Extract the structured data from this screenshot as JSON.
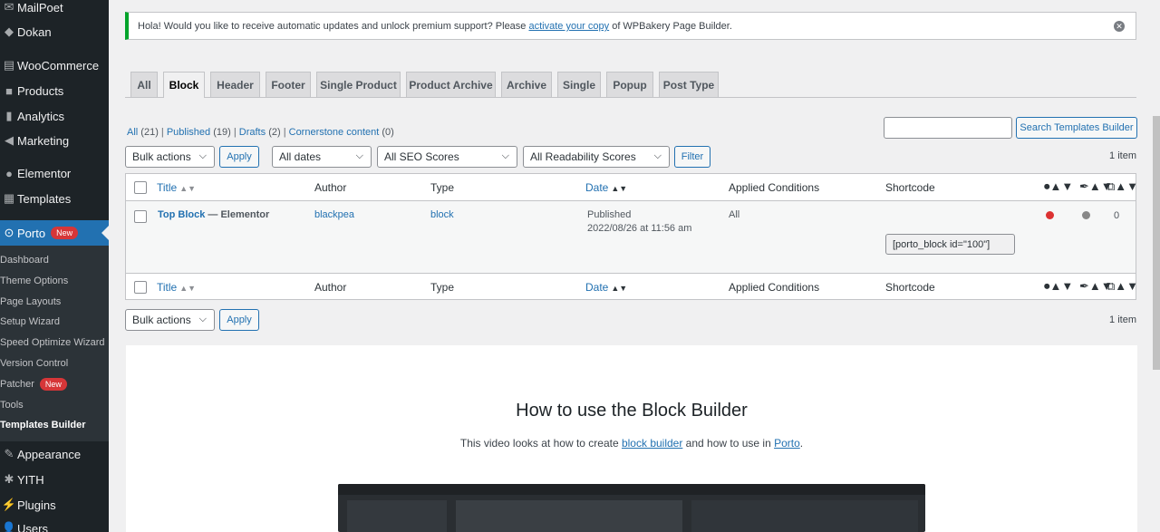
{
  "sidebar": {
    "items": [
      {
        "label": "MailPoet",
        "icon": "mailpoet-icon"
      },
      {
        "label": "Dokan",
        "icon": "dokan-icon"
      },
      {
        "label": "WooCommerce",
        "icon": "woocommerce-icon"
      },
      {
        "label": "Products",
        "icon": "products-icon"
      },
      {
        "label": "Analytics",
        "icon": "analytics-icon"
      },
      {
        "label": "Marketing",
        "icon": "marketing-icon"
      },
      {
        "label": "Elementor",
        "icon": "elementor-icon"
      },
      {
        "label": "Templates",
        "icon": "templates-icon"
      },
      {
        "label": "Porto",
        "icon": "porto-icon",
        "badge": "New"
      },
      {
        "label": "Appearance",
        "icon": "appearance-icon"
      },
      {
        "label": "YITH",
        "icon": "yith-icon"
      },
      {
        "label": "Plugins",
        "icon": "plugins-icon"
      },
      {
        "label": "Users",
        "icon": "users-icon"
      }
    ],
    "submenu": [
      {
        "label": "Dashboard"
      },
      {
        "label": "Theme Options"
      },
      {
        "label": "Page Layouts"
      },
      {
        "label": "Setup Wizard"
      },
      {
        "label": "Speed Optimize Wizard"
      },
      {
        "label": "Version Control"
      },
      {
        "label": "Patcher",
        "badge": "New"
      },
      {
        "label": "Tools"
      },
      {
        "label": "Templates Builder"
      }
    ]
  },
  "notice": {
    "before": "Hola! Would you like to receive automatic updates and unlock premium support? Please ",
    "link": "activate your copy",
    "after": " of WPBakery Page Builder."
  },
  "tabs": [
    "All",
    "Block",
    "Header",
    "Footer",
    "Single Product",
    "Product Archive",
    "Archive",
    "Single",
    "Popup",
    "Post Type"
  ],
  "views": {
    "all": "All",
    "all_count": "(21)",
    "published": "Published",
    "published_count": "(19)",
    "drafts": "Drafts",
    "drafts_count": "(2)",
    "cornerstone": "Cornerstone content",
    "cornerstone_count": "(0)"
  },
  "search": {
    "button": "Search Templates Builder"
  },
  "filters": {
    "bulk_actions": "Bulk actions",
    "apply": "Apply",
    "dates": "All dates",
    "seo": "All SEO Scores",
    "readability": "All Readability Scores",
    "filter": "Filter"
  },
  "items_count": "1 item",
  "columns": {
    "title": "Title",
    "author": "Author",
    "type": "Type",
    "date": "Date",
    "conditions": "Applied Conditions",
    "shortcode": "Shortcode"
  },
  "rows": [
    {
      "title": "Top Block",
      "suffix": " — Elementor",
      "author": "blackpea",
      "type": "block",
      "status": "Published",
      "date": "2022/08/26 at 11:56 am",
      "conditions": "All",
      "shortcode": "[porto_block id=\"100\"]",
      "links": "0",
      "seo_color": "#dc3232",
      "readability_color": "#888888"
    }
  ],
  "builder": {
    "title": "How to use the Block Builder",
    "desc_before": "This video looks at how to create ",
    "desc_link1": "block builder",
    "desc_middle": " and how to use in ",
    "desc_link2": "Porto",
    "desc_after": "."
  }
}
